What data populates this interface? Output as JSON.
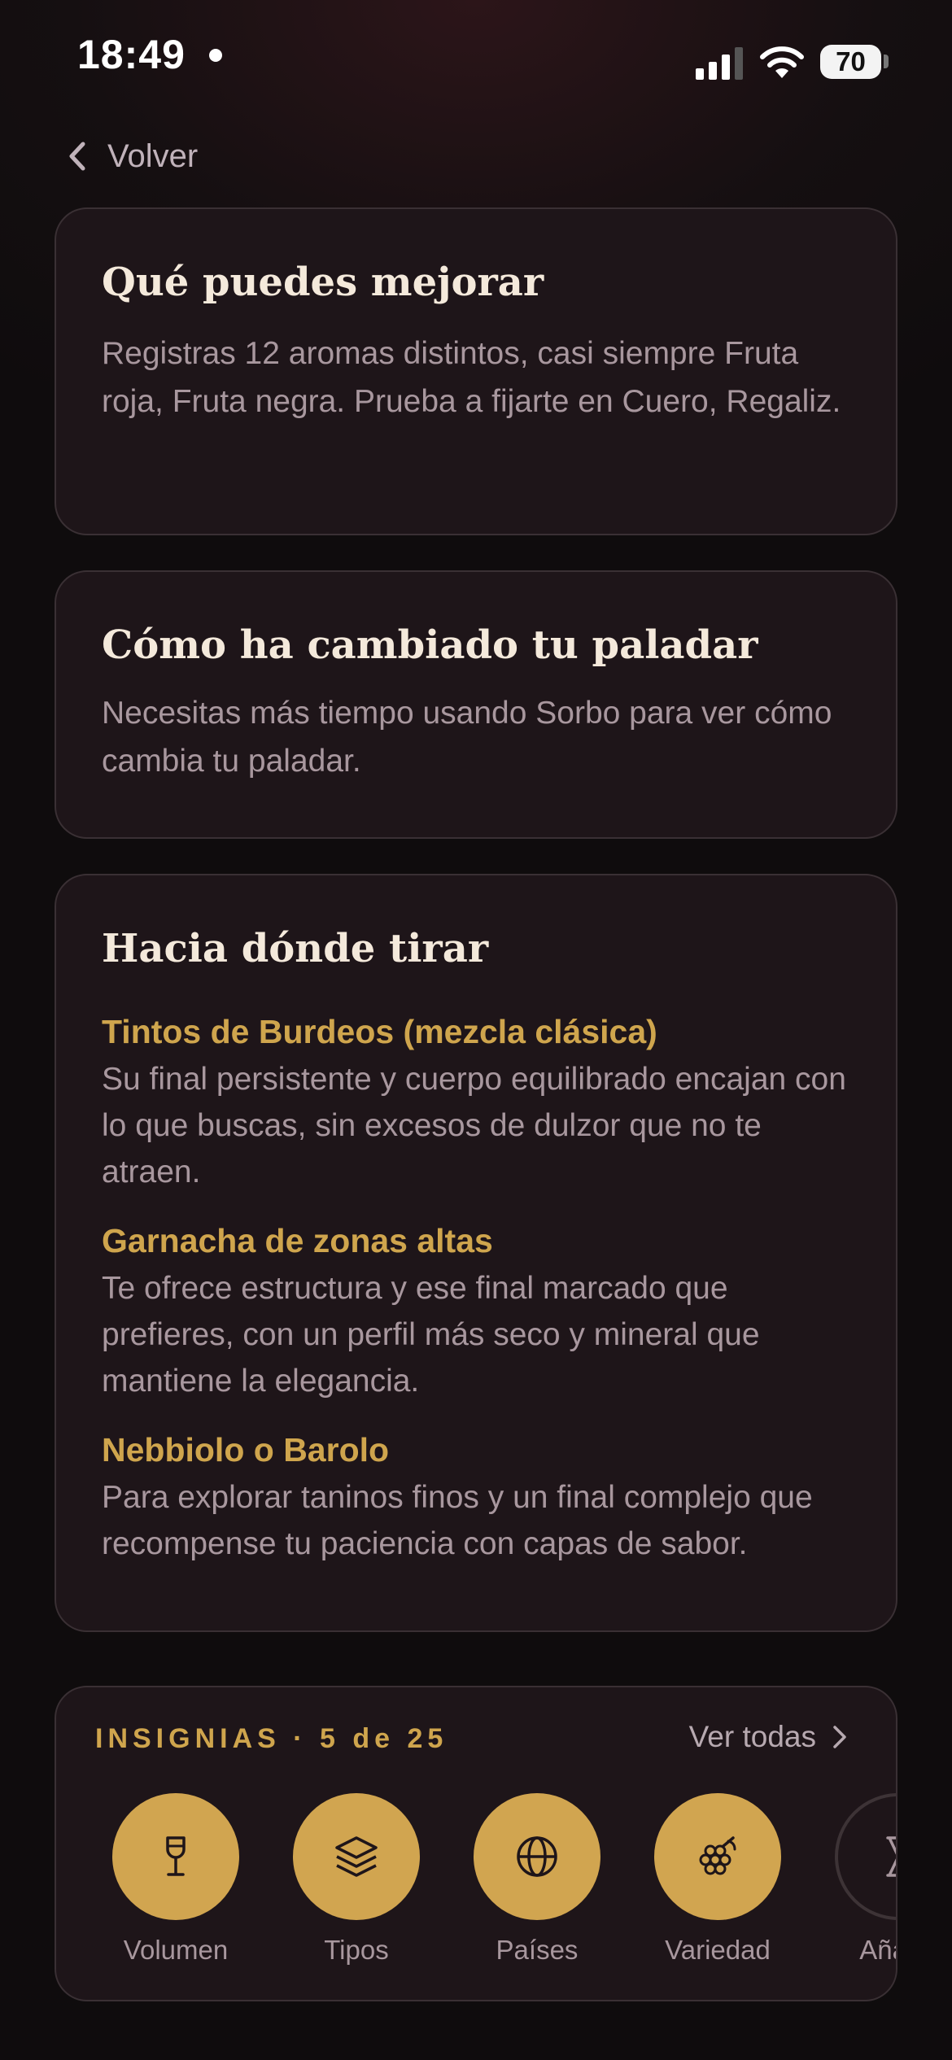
{
  "status_bar": {
    "time": "18:49",
    "battery": "70"
  },
  "nav": {
    "back_label": "Volver"
  },
  "improve": {
    "title": "Qué puedes mejorar",
    "text": "Registras 12 aromas distintos, casi siempre Fruta roja, Fruta negra. Prueba a fijarte en Cuero, Regaliz."
  },
  "palate": {
    "title": "Cómo ha cambiado tu paladar",
    "text": "Necesitas más tiempo usando Sorbo para ver cómo cambia tu paladar."
  },
  "direction": {
    "title": "Hacia dónde tirar",
    "items": [
      {
        "title": "Tintos de Burdeos (mezcla clásica)",
        "text": "Su final persistente y cuerpo equilibrado encajan con lo que buscas, sin excesos de dulzor que no te atraen."
      },
      {
        "title": "Garnacha de zonas altas",
        "text": "Te ofrece estructura y ese final marcado que prefieres, con un perfil más seco y mineral que mantiene la elegancia."
      },
      {
        "title": "Nebbiolo o Barolo",
        "text": "Para explorar taninos finos y un final complejo que recompense tu paciencia con capas de sabor."
      }
    ]
  },
  "badges": {
    "heading": "INSIGNIAS · 5 de 25",
    "see_all": "Ver todas",
    "accent_color": "#d1a550",
    "items": [
      {
        "label": "Volumen",
        "icon": "wine-glass-icon",
        "earned": true
      },
      {
        "label": "Tipos",
        "icon": "layers-icon",
        "earned": true
      },
      {
        "label": "Países",
        "icon": "globe-icon",
        "earned": true
      },
      {
        "label": "Variedad",
        "icon": "grapes-icon",
        "earned": true
      },
      {
        "label": "Añada",
        "icon": "hourglass-icon",
        "earned": false
      }
    ]
  }
}
